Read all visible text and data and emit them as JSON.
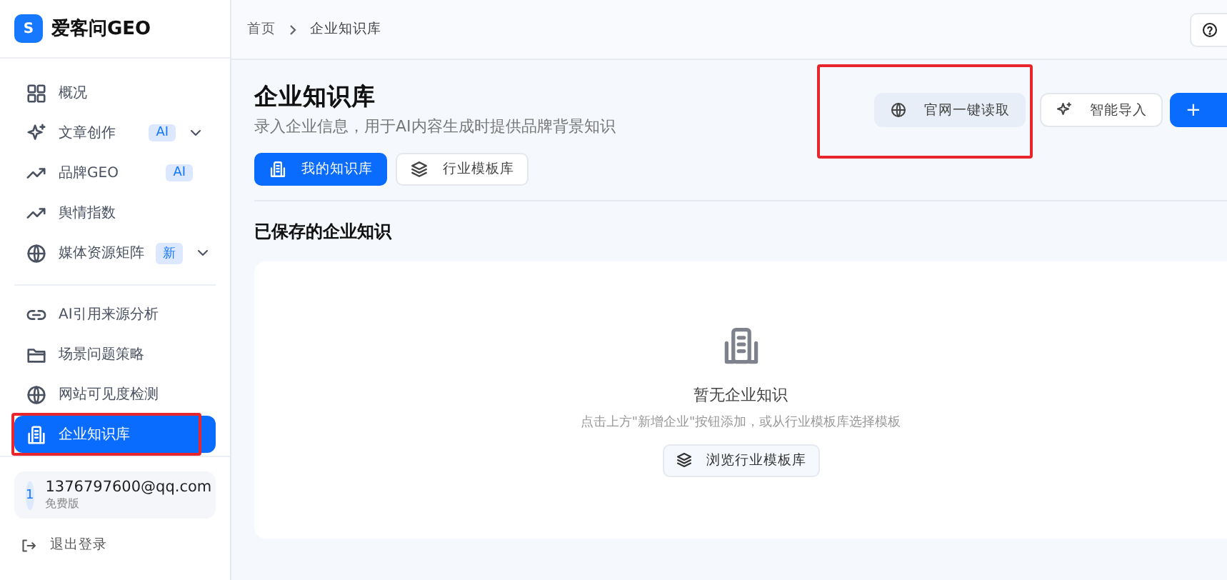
{
  "sidebar": {
    "logo": {
      "mark": "S",
      "name": "爱客问GEO"
    },
    "groups": [
      [
        {
          "label": "概况",
          "selected": false
        },
        {
          "label": "文章创作",
          "badge": "AI",
          "expandable": true,
          "selected": false
        },
        {
          "label": "品牌GEO",
          "badge": "AI",
          "selected": false
        },
        {
          "label": "舆情指数",
          "selected": false
        },
        {
          "label": "媒体资源矩阵",
          "badge": "新",
          "expandable": true,
          "selected": false
        }
      ],
      [
        {
          "label": "AI引用来源分析",
          "selected": false
        },
        {
          "label": "场景问题策略",
          "selected": false
        },
        {
          "label": "网站可见度检测",
          "selected": false
        },
        {
          "label": "企业知识库",
          "selected": true,
          "highlighted": true
        }
      ]
    ],
    "user": {
      "avatar": "1",
      "email": "1376797600@qq.com",
      "plan": "免费版"
    },
    "logout": "退出登录"
  },
  "header": {
    "breadcrumb": [
      "首页",
      "企业知识库"
    ]
  },
  "page": {
    "title": "企业知识库",
    "subtitle": "录入企业信息，用于AI内容生成时提供品牌背景知识",
    "actions": [
      {
        "kind": "soft",
        "label": "官网一键读取",
        "highlighted": true
      },
      {
        "kind": "outline",
        "label": "智能导入"
      },
      {
        "kind": "primary",
        "icon_text": "+"
      }
    ],
    "tabs": [
      {
        "label": "我的知识库",
        "selected": true
      },
      {
        "label": "行业模板库",
        "selected": false
      }
    ],
    "section_title": "已保存的企业知识",
    "empty": {
      "title": "暂无企业知识",
      "hint": "点击上方\"新增企业\"按钮添加，或从行业模板库选择模板",
      "button": "浏览行业模板库"
    }
  }
}
